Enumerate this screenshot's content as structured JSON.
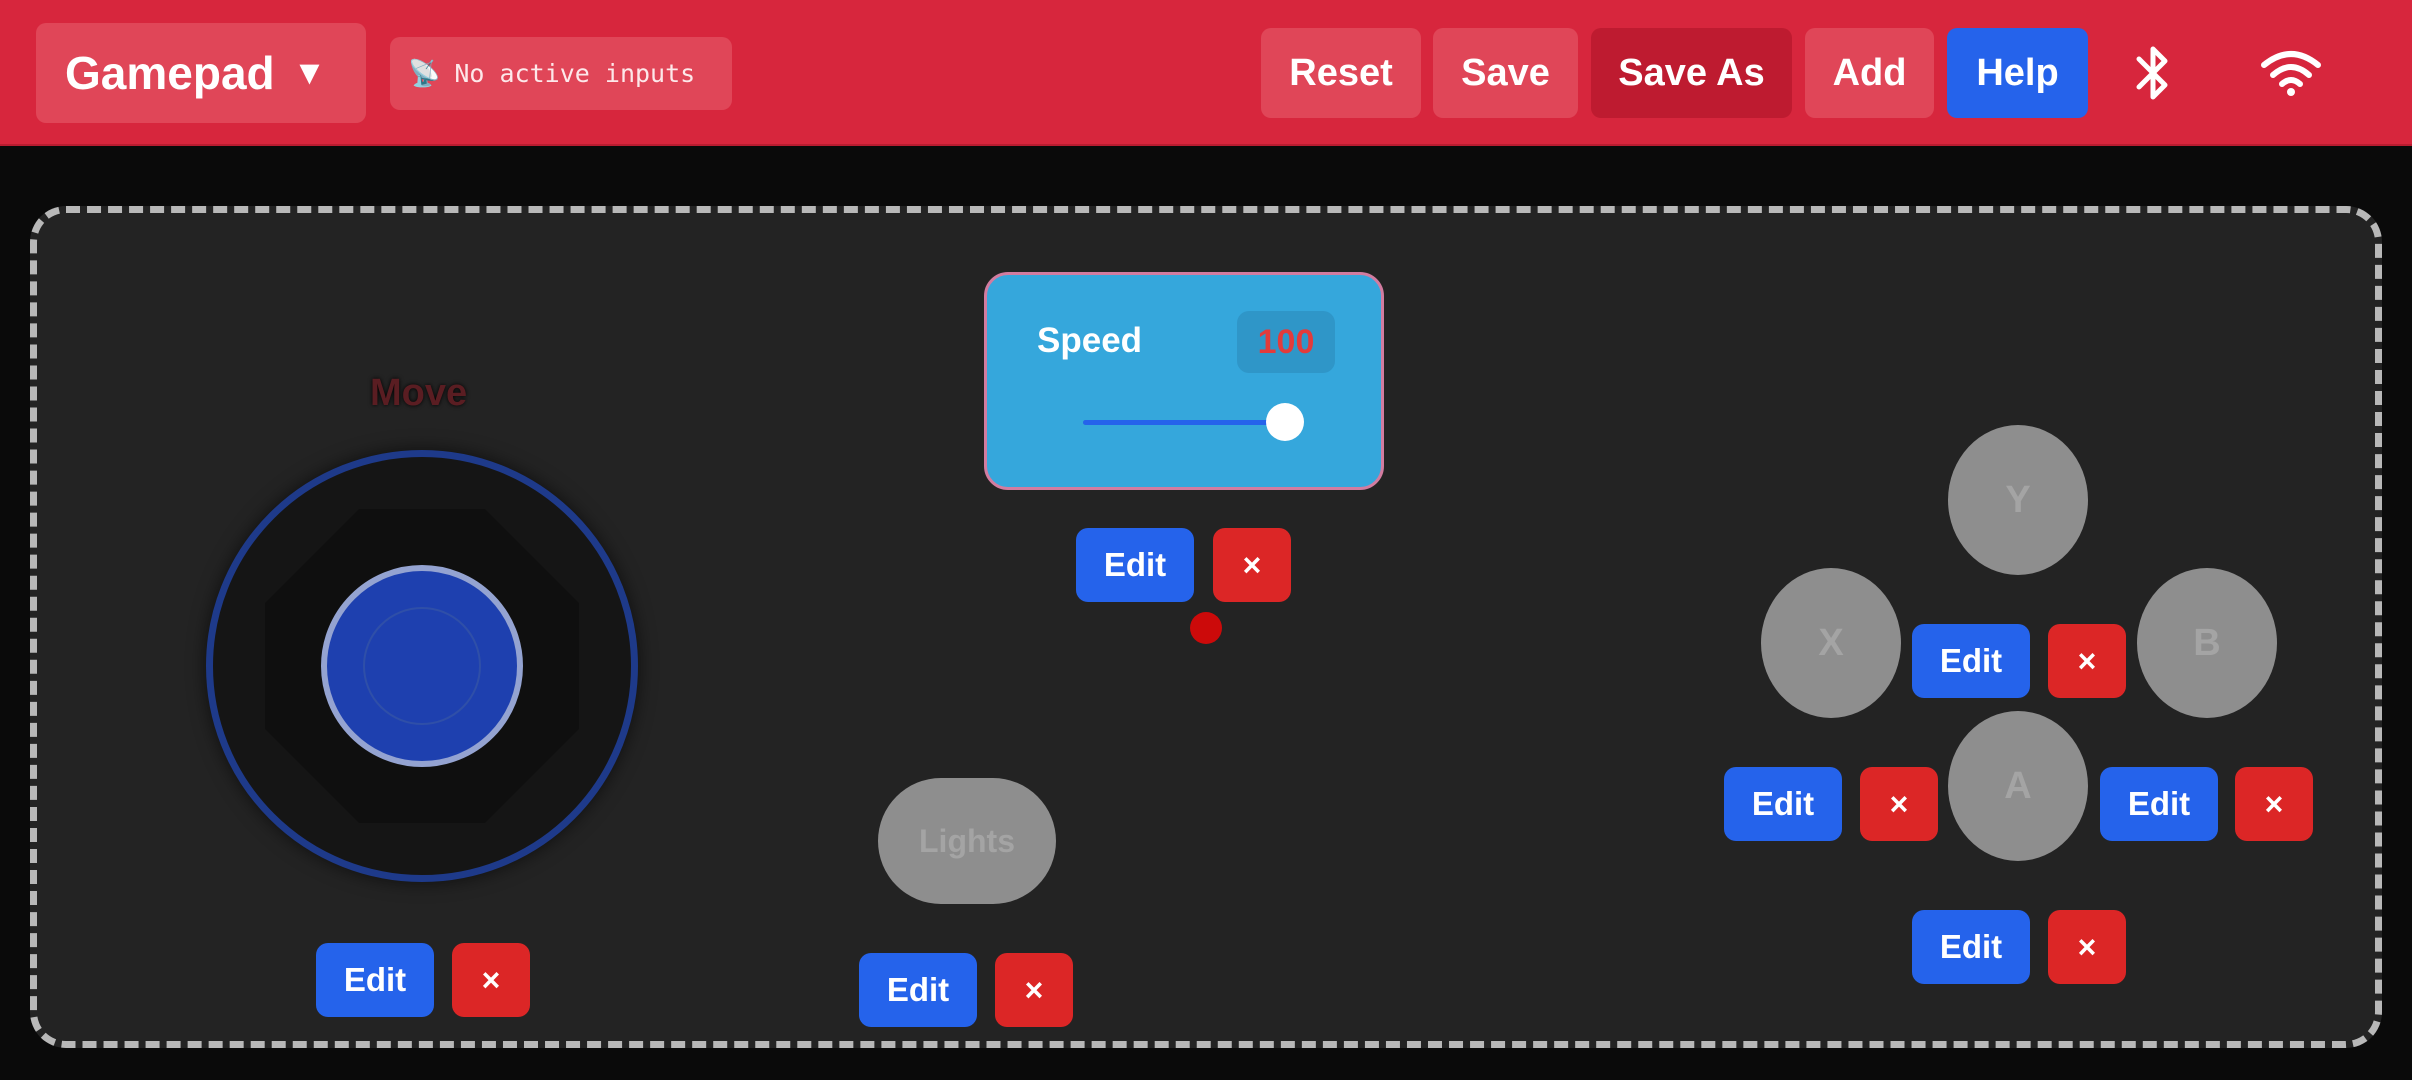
{
  "header": {
    "layout_name": "Gamepad",
    "layout_caret": "▼",
    "status_icon": "📡",
    "status_text": "No active inputs",
    "buttons": {
      "reset": "Reset",
      "save": "Save",
      "save_as": "Save As",
      "add": "Add",
      "help": "Help"
    },
    "icons": [
      "bluetooth-icon",
      "wifi-icon"
    ]
  },
  "canvas": {
    "joystick": {
      "label": "Move"
    },
    "slider": {
      "label": "Speed",
      "value": "100",
      "level_percent": 100
    },
    "buttons": {
      "lights": "Lights",
      "y": "Y",
      "x": "X",
      "b": "B",
      "a": "A"
    },
    "controls": {
      "edit_label": "Edit",
      "delete_label": "×"
    }
  },
  "colors": {
    "header": "#d7263d",
    "header_button": "#e04658",
    "edit": "#2563eb",
    "delete": "#dc2626",
    "slider_card": "#35a7dc"
  }
}
